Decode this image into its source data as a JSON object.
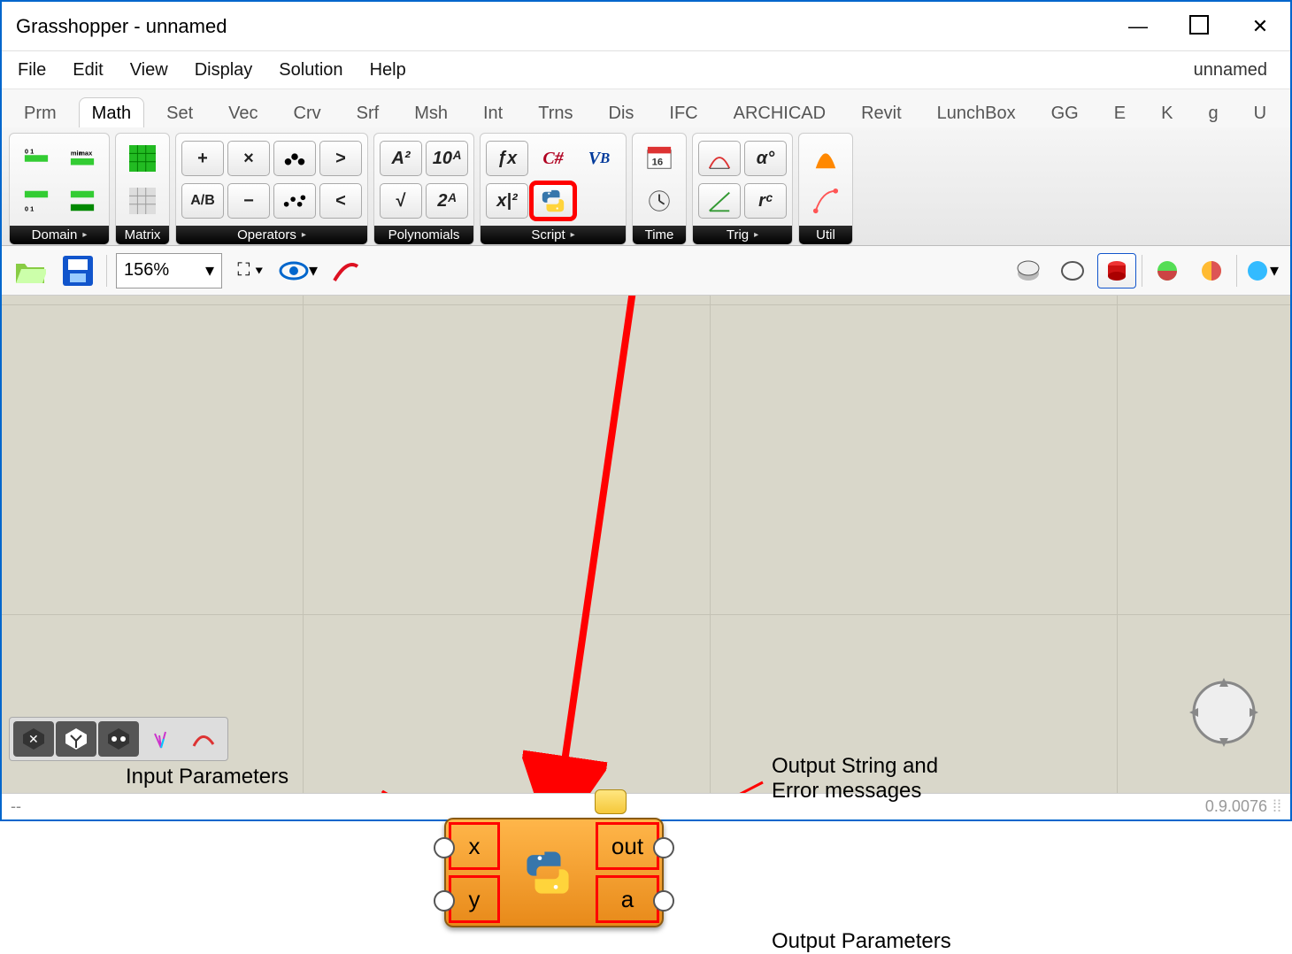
{
  "window": {
    "title": "Grasshopper - unnamed"
  },
  "menus": [
    "File",
    "Edit",
    "View",
    "Display",
    "Solution",
    "Help"
  ],
  "doc_label": "unnamed",
  "tabs": [
    "Prm",
    "Math",
    "Set",
    "Vec",
    "Crv",
    "Srf",
    "Msh",
    "Int",
    "Trns",
    "Dis",
    "IFC",
    "ARCHICAD",
    "Revit",
    "LunchBox",
    "GG",
    "E",
    "K",
    "g",
    "U"
  ],
  "active_tab_index": 1,
  "ribbon_panels": [
    {
      "name": "Domain",
      "expandable": true
    },
    {
      "name": "Matrix",
      "expandable": false
    },
    {
      "name": "Operators",
      "expandable": true
    },
    {
      "name": "Polynomials",
      "expandable": false
    },
    {
      "name": "Script",
      "expandable": true
    },
    {
      "name": "Time",
      "expandable": false
    },
    {
      "name": "Trig",
      "expandable": true
    },
    {
      "name": "Util",
      "expandable": false
    }
  ],
  "zoom": "156%",
  "node": {
    "inputs": [
      "x",
      "y"
    ],
    "outputs": [
      "out",
      "a"
    ]
  },
  "annotations": {
    "input_label": "Input Parameters",
    "out_label": "Output String and\nError messages",
    "out_param_label": "Output Parameters"
  },
  "status": {
    "left": "--",
    "version": "0.9.0076"
  }
}
